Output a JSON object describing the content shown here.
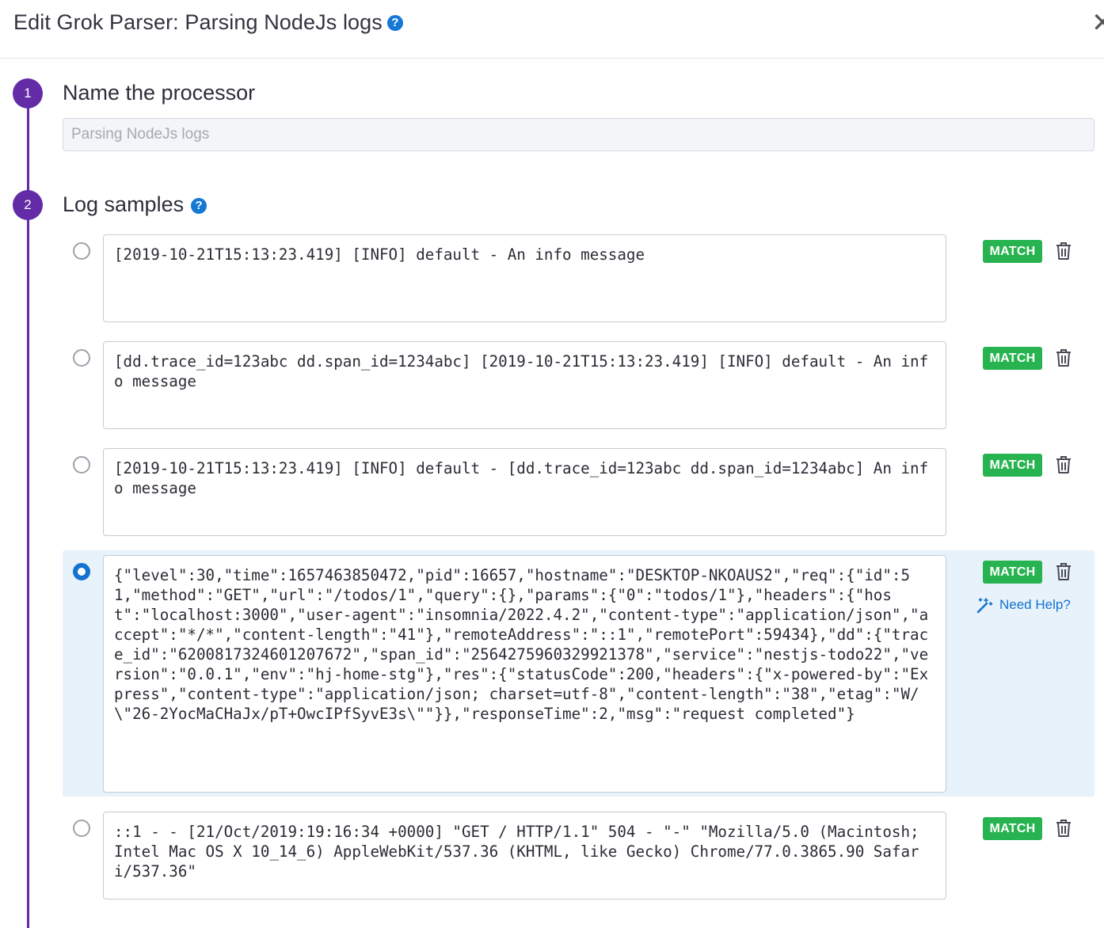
{
  "header": {
    "title": "Edit Grok Parser: Parsing NodeJs logs",
    "help_icon": "question-circle-icon",
    "close_icon": "close-icon"
  },
  "steps": [
    {
      "number": "1",
      "title": "Name the processor"
    },
    {
      "number": "2",
      "title": "Log samples"
    }
  ],
  "processor_name": {
    "value": "",
    "placeholder": "Parsing NodeJs logs"
  },
  "samples": [
    {
      "text": "[2019-10-21T15:13:23.419] [INFO] default - An info message",
      "status": "MATCH",
      "selected": false
    },
    {
      "text": "[dd.trace_id=123abc dd.span_id=1234abc] [2019-10-21T15:13:23.419] [INFO] default - An info message",
      "status": "MATCH",
      "selected": false
    },
    {
      "text": "[2019-10-21T15:13:23.419] [INFO] default - [dd.trace_id=123abc dd.span_id=1234abc] An info message",
      "status": "MATCH",
      "selected": false
    },
    {
      "text": "{\"level\":30,\"time\":1657463850472,\"pid\":16657,\"hostname\":\"DESKTOP-NKOAUS2\",\"req\":{\"id\":51,\"method\":\"GET\",\"url\":\"/todos/1\",\"query\":{},\"params\":{\"0\":\"todos/1\"},\"headers\":{\"host\":\"localhost:3000\",\"user-agent\":\"insomnia/2022.4.2\",\"content-type\":\"application/json\",\"accept\":\"*/*\",\"content-length\":\"41\"},\"remoteAddress\":\"::1\",\"remotePort\":59434},\"dd\":{\"trace_id\":\"6200817324601207672\",\"span_id\":\"2564275960329921378\",\"service\":\"nestjs-todo22\",\"version\":\"0.0.1\",\"env\":\"hj-home-stg\"},\"res\":{\"statusCode\":200,\"headers\":{\"x-powered-by\":\"Express\",\"content-type\":\"application/json; charset=utf-8\",\"content-length\":\"38\",\"etag\":\"W/\\\"26-2YocMaCHaJx/pT+OwcIPfSyvE3s\\\"\"}},\"responseTime\":2,\"msg\":\"request completed\"}",
      "status": "MATCH",
      "selected": true
    },
    {
      "text": "::1 - - [21/Oct/2019:19:16:34 +0000] \"GET / HTTP/1.1\" 504 - \"-\" \"Mozilla/5.0 (Macintosh; Intel Mac OS X 10_14_6) AppleWebKit/537.36 (KHTML, like Gecko) Chrome/77.0.3865.90 Safari/537.36\"",
      "status": "MATCH",
      "selected": false
    }
  ],
  "need_help": {
    "label": "Need Help?",
    "icon": "magic-wand-icon"
  },
  "colors": {
    "step_accent": "#632ca6",
    "match_green": "#27b34f",
    "link_blue": "#1473d1",
    "selected_row_bg": "#e8f2fb"
  }
}
